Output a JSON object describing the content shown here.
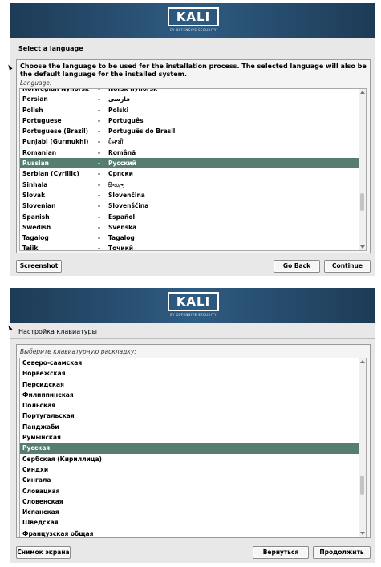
{
  "panel1": {
    "logo_text": "KALI",
    "logo_subtext": "BY OFFENSIVE SECURITY",
    "title": "Select a language",
    "description": "Choose the language to be used for the installation process. The selected language will also be the default language for the installed system.",
    "field_label": "Language:",
    "items": [
      {
        "name": "Norwegian Nynorsk",
        "native": "Norsk nynorsk"
      },
      {
        "name": "Persian",
        "native": "فارسی"
      },
      {
        "name": "Polish",
        "native": "Polski"
      },
      {
        "name": "Portuguese",
        "native": "Português"
      },
      {
        "name": "Portuguese (Brazil)",
        "native": "Português do Brasil"
      },
      {
        "name": "Punjabi (Gurmukhi)",
        "native": "ਪੰਜਾਬੀ"
      },
      {
        "name": "Romanian",
        "native": "Română"
      },
      {
        "name": "Russian",
        "native": "Русский"
      },
      {
        "name": "Serbian (Cyrillic)",
        "native": "Српски"
      },
      {
        "name": "Sinhala",
        "native": "සිංහල"
      },
      {
        "name": "Slovak",
        "native": "Slovenčina"
      },
      {
        "name": "Slovenian",
        "native": "Slovenščina"
      },
      {
        "name": "Spanish",
        "native": "Español"
      },
      {
        "name": "Swedish",
        "native": "Svenska"
      },
      {
        "name": "Tagalog",
        "native": "Tagalog"
      },
      {
        "name": "Tajik",
        "native": "Точикӣ"
      }
    ],
    "separator": "-",
    "selected_index": 7,
    "buttons": {
      "screenshot": "Screenshot",
      "back": "Go Back",
      "continue": "Continue"
    }
  },
  "panel2": {
    "logo_text": "KALI",
    "logo_subtext": "BY OFFENSIVE SECURITY",
    "title": "Настройка клавиатуры",
    "field_label": "Выберите клавиатурную раскладку:",
    "items": [
      "Северо-саамская",
      "Норвежская",
      "Персидская",
      "Филиппинская",
      "Польская",
      "Португальская",
      "Панджаби",
      "Румынская",
      "Русская",
      "Сербская (Кириллица)",
      "Синдхи",
      "Сингала",
      "Словацкая",
      "Словенская",
      "Испанская",
      "Шведская",
      "Французская общая"
    ],
    "selected_index": 8,
    "buttons": {
      "screenshot": "Снимок экрана",
      "back": "Вернуться",
      "continue": "Продолжить"
    }
  },
  "colors": {
    "banner": "#2a5275",
    "selection": "#557d72",
    "panel_bg": "#e8e8e8"
  }
}
